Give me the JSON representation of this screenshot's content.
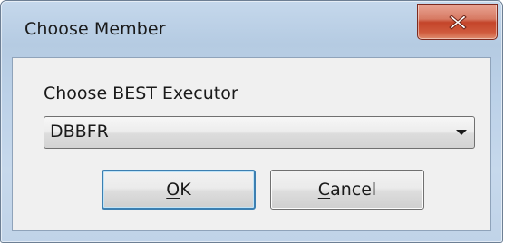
{
  "window": {
    "title": "Choose Member"
  },
  "close_button": {
    "icon": "close-icon"
  },
  "form": {
    "label": "Choose BEST Executor",
    "selected_value": "DBBFR"
  },
  "buttons": {
    "ok_access_key": "O",
    "ok_rest": "K",
    "cancel_access_key": "C",
    "cancel_rest": "ancel"
  },
  "colors": {
    "close_button": "#c4452a",
    "default_button_border": "#3c7fb1"
  }
}
